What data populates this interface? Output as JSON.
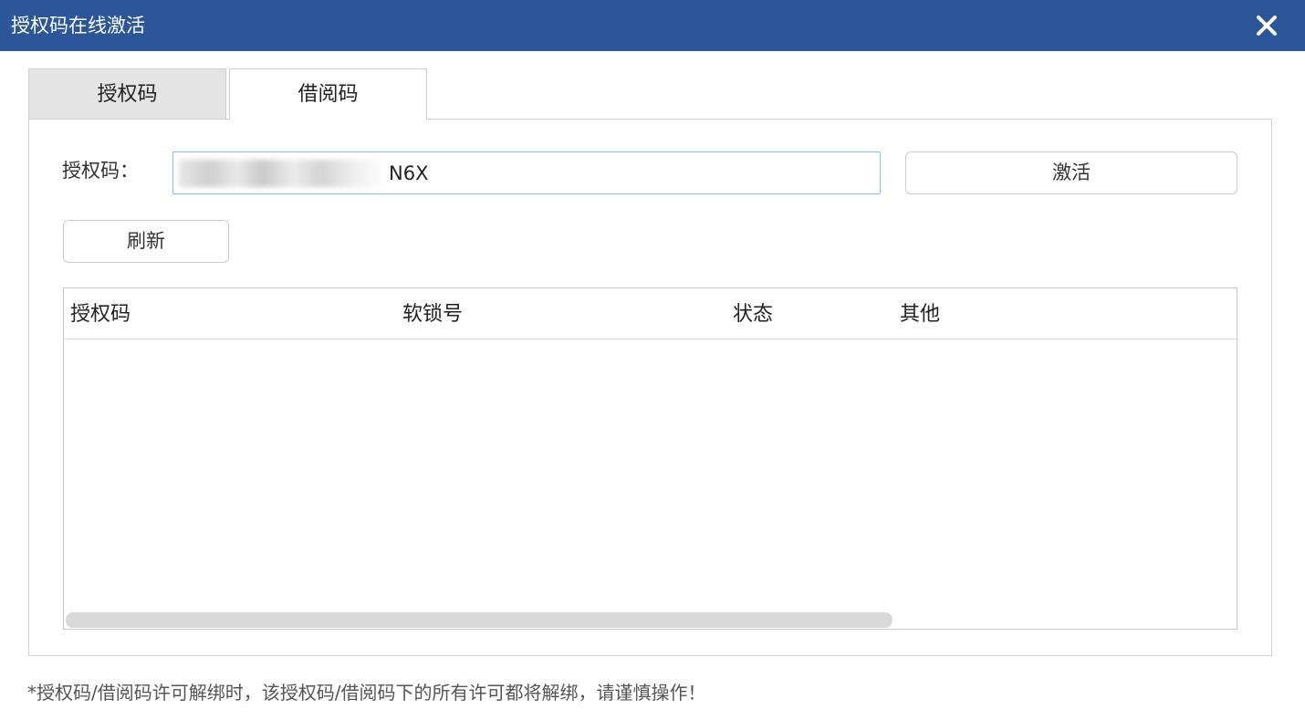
{
  "window": {
    "title": "授权码在线激活",
    "close_icon": "close-icon"
  },
  "tabs": [
    {
      "label": "授权码",
      "active": false
    },
    {
      "label": "借阅码",
      "active": true
    }
  ],
  "form": {
    "code_label": "授权码：",
    "code_value_visible": "N6X",
    "activate_label": "激活",
    "refresh_label": "刷新"
  },
  "table": {
    "columns": [
      "授权码",
      "软锁号",
      "状态",
      "其他"
    ],
    "rows": []
  },
  "footnote": "*授权码/借阅码许可解绑时，该授权码/借阅码下的所有许可都将解绑，请谨慎操作！",
  "colors": {
    "titlebar": "#2b579a",
    "input_focus_border": "#7fc4ec",
    "inactive_tab": "#e4e4e4"
  }
}
